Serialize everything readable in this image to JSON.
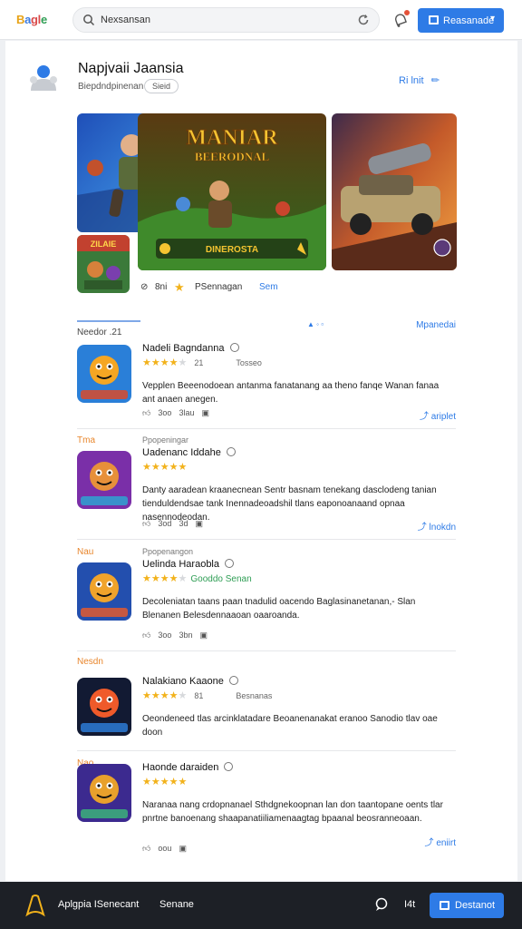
{
  "topbar": {
    "logo": [
      "B",
      "a",
      "gl",
      "e"
    ],
    "search_value": "Nexsansan",
    "button_label": "Reasanade",
    "button_chevron": "▾"
  },
  "profile": {
    "name": "Napjvaii Jaansia",
    "subtitle": "Biepdndpinenan",
    "tag": "Sieid",
    "edit_label": "Ri lnit"
  },
  "banner": {
    "featured_title_line1": "MANIAR",
    "featured_title_line2": "BEERODNAL",
    "featured_caption": "DINEROSTA",
    "thumb_caption": "ZILAIE"
  },
  "meta": {
    "count": "8ni",
    "category": "PSennagan",
    "link": "Sem"
  },
  "section": {
    "title": "Needor .21",
    "dots": "▲ ◦ ▫",
    "more": "Mpanedai"
  },
  "apps": [
    {
      "label": "",
      "title": "Nadeli Bagndanna",
      "category": "",
      "rating": 4,
      "rating_text": "21",
      "extra": "Tosseo",
      "badge": "",
      "description": "Vepplen Beeenodoean antanma fanatanang aa theno fanqe Wanan fanaa ant anaen anegen.",
      "stats": [
        "3oo",
        "3lau"
      ],
      "install": "ariplet",
      "icon_colors": [
        "#2a7fd8",
        "#f5a623",
        "#d94a2c"
      ]
    },
    {
      "label": "Tma",
      "title": "Uadenanc Iddahe",
      "category": "Ppopeningar",
      "rating": 5,
      "rating_text": "",
      "extra": "",
      "badge": "",
      "description": "Danty aaradean kraanecnean Sentr basnam tenekang dasclodeng tanian tienduldendsae tank Inennadeoadshil tlans eaponoanaand opnaa nasennodeodan.",
      "stats": [
        "3od",
        "3d"
      ],
      "install": "lnokdn",
      "icon_colors": [
        "#7a2fa8",
        "#e7903a",
        "#2fa2d1"
      ]
    },
    {
      "label": "Nau",
      "title": "Uelinda Haraobla",
      "category": "Ppopenangon",
      "rating": 4,
      "rating_text": "",
      "extra": "",
      "badge": "Gooddo Senan",
      "description": "Decoleniatan taans paan tnadulid oacendo Baglasinanetanan,- Slan Blenanen Belesdennaaoan oaaroanda.",
      "stats": [
        "3oo",
        "3bn"
      ],
      "install": "",
      "icon_colors": [
        "#234fae",
        "#f0a32b",
        "#e2592f"
      ]
    },
    {
      "label": "Nesdn",
      "title": "Nalakiano Kaaone",
      "category": "",
      "rating": 4,
      "rating_text": "81",
      "extra": "Besnanas",
      "badge": "",
      "description": "Oeondeneed tlas arcinklatadare Beoanenanakat eranoo Sanodio tlav oae doon",
      "stats": [],
      "install": "",
      "icon_colors": [
        "#121a33",
        "#ef5a2a",
        "#2d7bd6"
      ]
    },
    {
      "label": "Nao",
      "title": "Haonde daraiden",
      "category": "",
      "rating": 5,
      "rating_text": "",
      "extra": "",
      "badge": "",
      "description": "Naranaa nang crdopnanael Sthdgnekoopnan lan don taantopane oents tlar pnrtne banoenang shaapanatiiliamenaagtag bpaanal beosranneoaan.",
      "stats": [
        "oou"
      ],
      "install": "eniirt",
      "icon_colors": [
        "#3c2a8f",
        "#e8a02c",
        "#3bb27a"
      ]
    }
  ],
  "bottombar": {
    "app_name": "Aplgpia ISenecant",
    "link": "Senane",
    "count": "I4t",
    "button_label": "Destanot"
  },
  "colors": {
    "accent": "#2e7be6",
    "star": "#f2b21b",
    "orange_label": "#e8862c",
    "bottom_bg": "#1d2026"
  }
}
